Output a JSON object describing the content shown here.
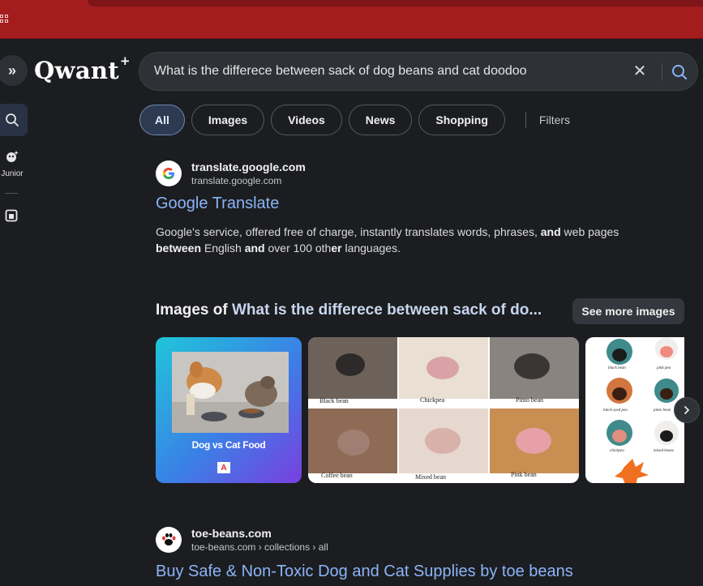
{
  "brand": {
    "logo_text": "Qwant",
    "logo_mark": "+"
  },
  "colors": {
    "browser_bar": "#a31c1e",
    "link": "#8ab4f8",
    "background": "#1c1d20"
  },
  "rail": {
    "junior_label": "Junior"
  },
  "search": {
    "query": "What is the differece between sack of dog beans and cat doodoo"
  },
  "tabs": [
    {
      "label": "All",
      "active": true
    },
    {
      "label": "Images"
    },
    {
      "label": "Videos"
    },
    {
      "label": "News"
    },
    {
      "label": "Shopping"
    }
  ],
  "filters_label": "Filters",
  "results": [
    {
      "site_name": "translate.google.com",
      "url": "translate.google.com",
      "title": "Google Translate",
      "snippet_parts": [
        {
          "t": "Google's service, offered free of charge, instantly translates words, phrases, "
        },
        {
          "t": "and",
          "b": true
        },
        {
          "t": " web pages "
        },
        {
          "t": "between",
          "b": true
        },
        {
          "t": " English "
        },
        {
          "t": "and",
          "b": true
        },
        {
          "t": " over 100 oth"
        },
        {
          "t": "er",
          "b": true
        },
        {
          "t": " languages."
        }
      ]
    },
    {
      "site_name": "toe-beans.com",
      "url": "toe-beans.com › collections › all",
      "title": "Buy Safe & Non-Toxic Dog and Cat Supplies by toe beans"
    }
  ],
  "images": {
    "heading_prefix": "Images of ",
    "heading_query": "What is the differece between sack of do...",
    "see_more_label": "See more images",
    "card1_caption": "Dog vs Cat Food",
    "card1_badge": "A",
    "card2_labels": [
      "Black bean",
      "Chickpea",
      "Pinto bean",
      "Coffee bean",
      "Mixed bean",
      "Pink bean"
    ],
    "card3_labels": [
      "black bean",
      "pink pea",
      "black eyed pea",
      "pinto bean",
      "chickpea",
      "mixed beans"
    ]
  }
}
